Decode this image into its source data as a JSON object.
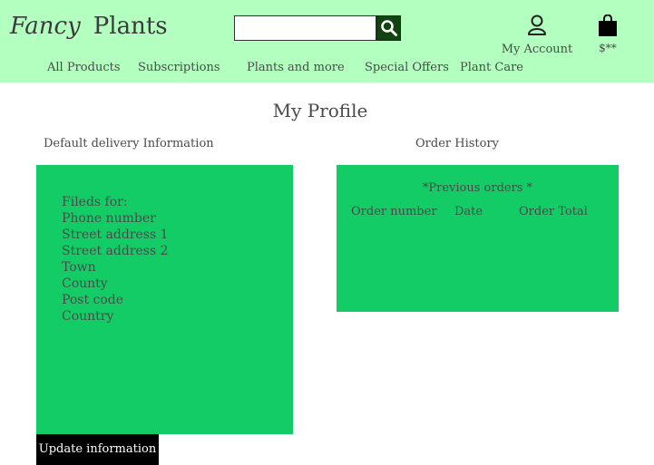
{
  "brand": {
    "word1": "Fancy",
    "word2": "Plants"
  },
  "search": {
    "placeholder": ""
  },
  "account": {
    "label": "My Account"
  },
  "cart": {
    "label": "$**"
  },
  "nav": [
    "All Products",
    "Subscriptions",
    "Plants and more",
    "Special Offers",
    "Plant Care"
  ],
  "page_title": "My Profile",
  "delivery": {
    "title": "Default delivery Information",
    "fields": [
      "Fileds for:",
      "Phone number",
      "Street address 1",
      "Street address 2",
      "Town",
      "County",
      "Post code",
      "Country"
    ],
    "button": "Update information"
  },
  "orders": {
    "title": "Order History",
    "previous": "*Previous orders *",
    "columns": [
      "Order number",
      "Date",
      "Order Total"
    ]
  },
  "colors": {
    "header": "#b3ffbf",
    "panel": "#14cc66",
    "search_button": "#114411"
  }
}
